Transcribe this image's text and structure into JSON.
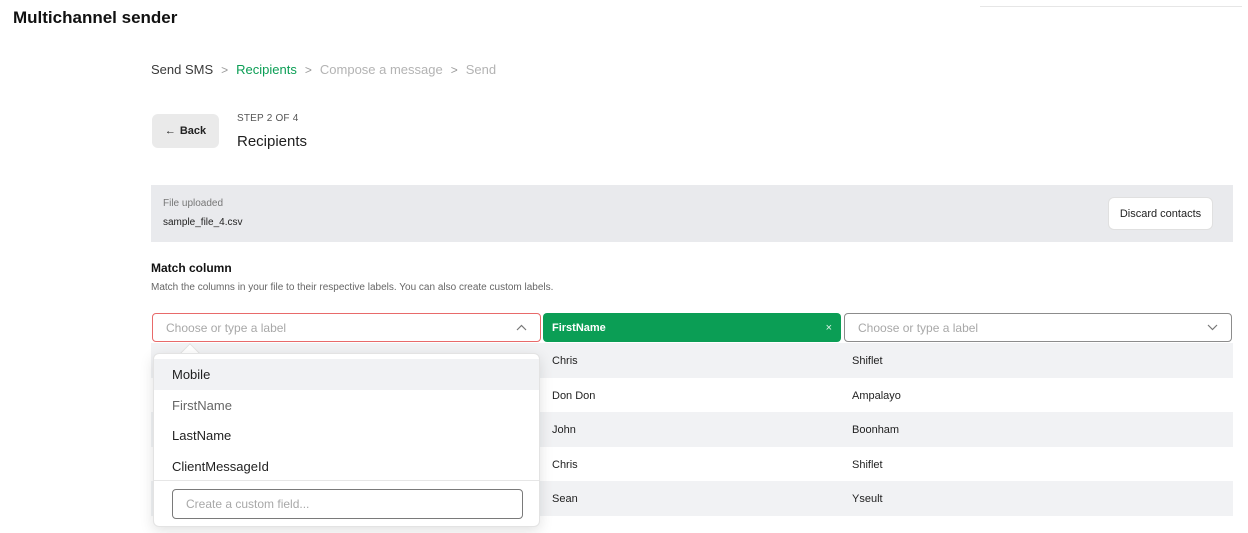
{
  "app": {
    "title": "Multichannel sender"
  },
  "breadcrumb": {
    "items": [
      {
        "label": "Send SMS",
        "state": "done"
      },
      {
        "label": "Recipients",
        "state": "active"
      },
      {
        "label": "Compose a message",
        "state": "disabled"
      },
      {
        "label": "Send",
        "state": "disabled"
      }
    ],
    "separator": ">"
  },
  "header": {
    "back_arrow": "←",
    "back_label": "Back",
    "step_label": "STEP 2 OF 4",
    "step_title": "Recipients"
  },
  "file": {
    "label": "File uploaded",
    "name": "sample_file_4.csv",
    "discard_label": "Discard contacts"
  },
  "match": {
    "title": "Match column",
    "description": "Match the columns in your file to their respective labels. You can also create custom labels."
  },
  "columns": [
    {
      "placeholder": "Choose or type a label",
      "chevron": "^",
      "state": "open-error"
    },
    {
      "value": "FirstName",
      "clear": "×",
      "state": "selected"
    },
    {
      "placeholder": "Choose or type a label",
      "chevron": "v",
      "state": "default"
    }
  ],
  "rows": [
    {
      "c1": "",
      "c2": "Chris",
      "c3": "Shiflet"
    },
    {
      "c1": "",
      "c2": "Don Don",
      "c3": "Ampalayo"
    },
    {
      "c1": "",
      "c2": "John",
      "c3": "Boonham"
    },
    {
      "c1": "",
      "c2": "Chris",
      "c3": "Shiflet"
    },
    {
      "c1": "",
      "c2": "Sean",
      "c3": "Yseult"
    }
  ],
  "dropdown": {
    "options": [
      "Mobile",
      "FirstName",
      "LastName",
      "ClientMessageId"
    ],
    "custom_placeholder": "Create a custom field..."
  },
  "colors": {
    "accent_green": "#0b9e55",
    "error_red": "#e86a6a",
    "panel_grey": "#e9eaed",
    "row_shade": "#f1f2f4"
  }
}
